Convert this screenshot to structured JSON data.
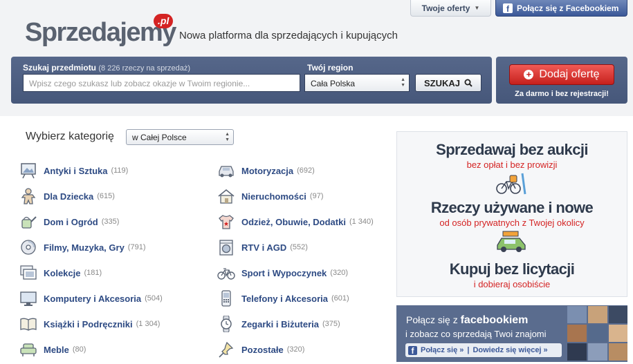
{
  "header": {
    "offers_button": "Twoje oferty",
    "facebook_button": "Połącz się z Facebookiem",
    "logo_text": "Sprzedajemy",
    "logo_suffix": ".pl",
    "tagline": "Nowa platforma dla sprzedających i kupujących"
  },
  "search": {
    "label": "Szukaj przedmiotu",
    "count_note": "(8 226 rzeczy na sprzedaż)",
    "placeholder": "Wpisz czego szukasz lub zobacz okazje w Twoim regionie...",
    "region_label": "Twój region",
    "region_value": "Cała Polska",
    "button": "SZUKAJ"
  },
  "add_offer": {
    "button": "Dodaj ofertę",
    "subtext": "Za darmo i bez rejestracji!"
  },
  "categories": {
    "title": "Wybierz kategorię",
    "scope_value": "w Całej Polsce",
    "left": [
      {
        "name": "Antyki i Sztuka",
        "count": "(119)",
        "icon": "painting-icon"
      },
      {
        "name": "Dla Dziecka",
        "count": "(615)",
        "icon": "gingerbread-icon"
      },
      {
        "name": "Dom i Ogród",
        "count": "(335)",
        "icon": "watering-can-icon"
      },
      {
        "name": "Filmy, Muzyka, Gry",
        "count": "(791)",
        "icon": "disc-icon"
      },
      {
        "name": "Kolekcje",
        "count": "(181)",
        "icon": "stamps-icon"
      },
      {
        "name": "Komputery i Akcesoria",
        "count": "(504)",
        "icon": "monitor-icon"
      },
      {
        "name": "Książki i Podręczniki",
        "count": "(1 304)",
        "icon": "book-icon"
      },
      {
        "name": "Meble",
        "count": "(80)",
        "icon": "armchair-icon"
      }
    ],
    "right": [
      {
        "name": "Motoryzacja",
        "count": "(692)",
        "icon": "car-icon"
      },
      {
        "name": "Nieruchomości",
        "count": "(97)",
        "icon": "house-icon"
      },
      {
        "name": "Odzież, Obuwie, Dodatki",
        "count": "(1 340)",
        "icon": "tshirt-icon"
      },
      {
        "name": "RTV i AGD",
        "count": "(552)",
        "icon": "washing-machine-icon"
      },
      {
        "name": "Sport i Wypoczynek",
        "count": "(320)",
        "icon": "bicycle-icon"
      },
      {
        "name": "Telefony i Akcesoria",
        "count": "(601)",
        "icon": "phone-icon"
      },
      {
        "name": "Zegarki i Biżuteria",
        "count": "(375)",
        "icon": "watch-icon"
      },
      {
        "name": "Pozostałe",
        "count": "(320)",
        "icon": "pin-icon"
      }
    ]
  },
  "promo": {
    "h1": "Sprzedawaj bez aukcji",
    "s1": "bez opłat i bez prowizji",
    "h2": "Rzeczy używane i nowe",
    "s2": "od osób prywatnych z Twojej okolicy",
    "h3": "Kupuj bez licytacji",
    "s3": "i dobieraj osobiście"
  },
  "fb_box": {
    "line1_pre": "Połącz się z",
    "line1_brand": "facebookiem",
    "line2": "i zobacz co sprzedają Twoi znajomi",
    "connect": "Połącz się »",
    "separator": "|",
    "more": "Dowiedz się więcej »"
  },
  "colors": {
    "accent_red": "#d42323",
    "panel_blue": "#4f6083",
    "link_blue": "#2d4a83",
    "facebook_blue": "#3b5898"
  }
}
